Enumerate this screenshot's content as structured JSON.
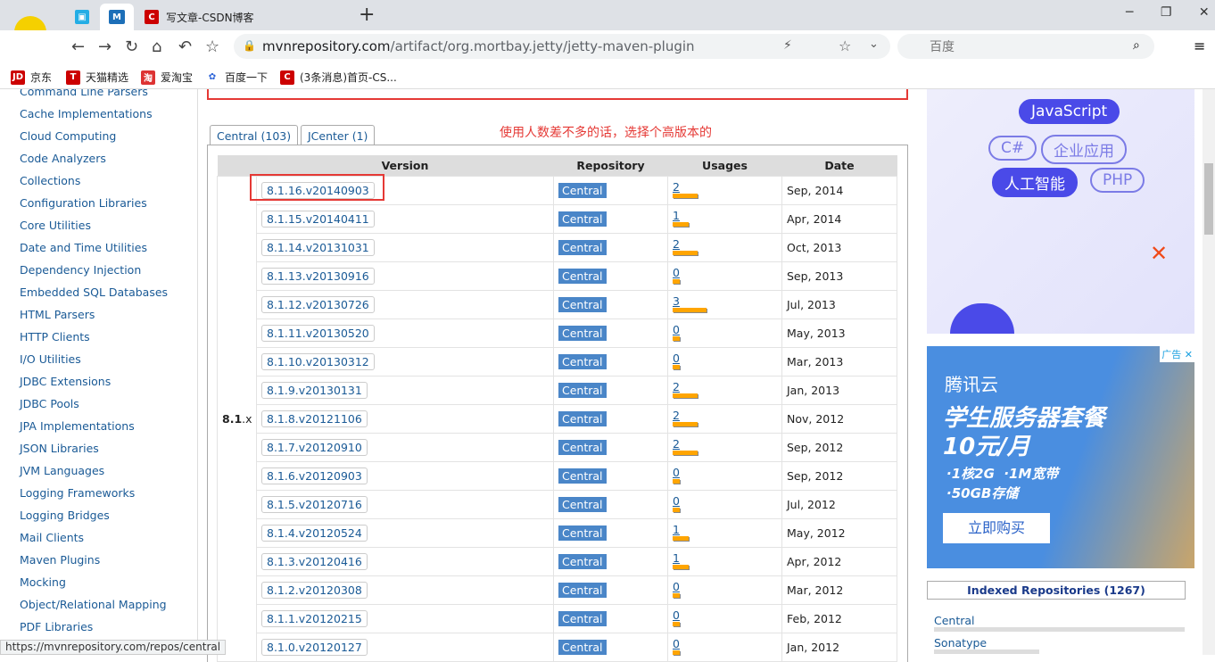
{
  "browser": {
    "tabs": [
      {
        "label": "",
        "icon": "bilibili-icon"
      },
      {
        "label": "",
        "icon": "mvn-icon"
      },
      {
        "label": "写文章-CSDN博客",
        "icon": "csdn-icon"
      }
    ],
    "url_host": "mvnrepository.com",
    "url_path": "/artifact/org.mortbay.jetty/jetty-maven-plugin",
    "search_placeholder": "百度",
    "bookmarks": [
      "京东",
      "天猫精选",
      "爱淘宝",
      "百度一下",
      "(3条消息)首页-CS..."
    ],
    "status_url": "https://mvnrepository.com/repos/central"
  },
  "sidebar": {
    "items": [
      "Command Line Parsers",
      "Cache Implementations",
      "Cloud Computing",
      "Code Analyzers",
      "Collections",
      "Configuration Libraries",
      "Core Utilities",
      "Date and Time Utilities",
      "Dependency Injection",
      "Embedded SQL Databases",
      "HTML Parsers",
      "HTTP Clients",
      "I/O Utilities",
      "JDBC Extensions",
      "JDBC Pools",
      "JPA Implementations",
      "JSON Libraries",
      "JVM Languages",
      "Logging Frameworks",
      "Logging Bridges",
      "Mail Clients",
      "Maven Plugins",
      "Mocking",
      "Object/Relational Mapping",
      "PDF Libraries"
    ]
  },
  "main": {
    "tabs": [
      "Central (103)",
      "JCenter (1)"
    ],
    "note": "使用人数差不多的话，选择个高版本的",
    "columns": [
      "Version",
      "Repository",
      "Usages",
      "Date"
    ],
    "group": "8.1",
    "group_suffix": ".x",
    "rows": [
      [
        "8.1.16.v20140903",
        "Central",
        "2",
        "Sep, 2014"
      ],
      [
        "8.1.15.v20140411",
        "Central",
        "1",
        "Apr, 2014"
      ],
      [
        "8.1.14.v20131031",
        "Central",
        "2",
        "Oct, 2013"
      ],
      [
        "8.1.13.v20130916",
        "Central",
        "0",
        "Sep, 2013"
      ],
      [
        "8.1.12.v20130726",
        "Central",
        "3",
        "Jul, 2013"
      ],
      [
        "8.1.11.v20130520",
        "Central",
        "0",
        "May, 2013"
      ],
      [
        "8.1.10.v20130312",
        "Central",
        "0",
        "Mar, 2013"
      ],
      [
        "8.1.9.v20130131",
        "Central",
        "2",
        "Jan, 2013"
      ],
      [
        "8.1.8.v20121106",
        "Central",
        "2",
        "Nov, 2012"
      ],
      [
        "8.1.7.v20120910",
        "Central",
        "2",
        "Sep, 2012"
      ],
      [
        "8.1.6.v20120903",
        "Central",
        "0",
        "Sep, 2012"
      ],
      [
        "8.1.5.v20120716",
        "Central",
        "0",
        "Jul, 2012"
      ],
      [
        "8.1.4.v20120524",
        "Central",
        "1",
        "May, 2012"
      ],
      [
        "8.1.3.v20120416",
        "Central",
        "1",
        "Apr, 2012"
      ],
      [
        "8.1.2.v20120308",
        "Central",
        "0",
        "Mar, 2012"
      ],
      [
        "8.1.1.v20120215",
        "Central",
        "0",
        "Feb, 2012"
      ],
      [
        "8.1.0.v20120127",
        "Central",
        "0",
        "Jan, 2012"
      ]
    ]
  },
  "ads": {
    "tags": [
      "JavaScript",
      "C#",
      "企业应用",
      "人工智能",
      "PHP"
    ],
    "brand": "腾讯云",
    "headline": "学生服务器套餐",
    "price": "10元/月",
    "bullet1": "·1核2G  ·1M宽带",
    "bullet2": "·50GB存储",
    "cta": "立即购买",
    "ad_label": "广告"
  },
  "repos": {
    "title": "Indexed Repositories (1267)",
    "items": [
      "Central",
      "Sonatype"
    ]
  }
}
